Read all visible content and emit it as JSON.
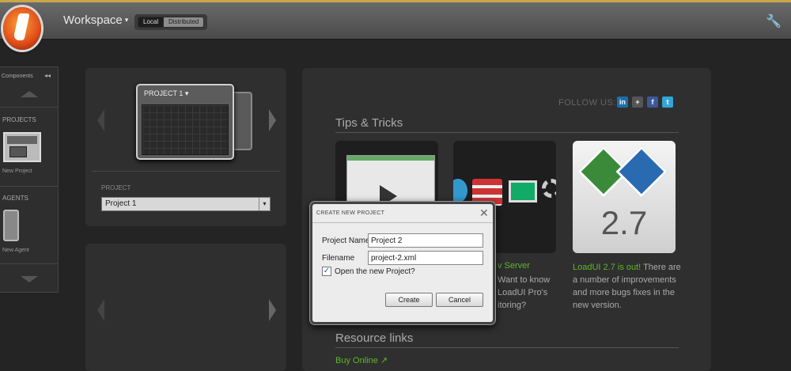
{
  "colors": {
    "accent_green": "#5cb82a",
    "logo_orange": "#e4521a"
  },
  "topbar": {
    "workspace_label": "Workspace",
    "workspace_caret": "▾",
    "mode_local": "Local",
    "mode_distributed": "Distributed",
    "wrench_glyph": "🔧"
  },
  "sidebar": {
    "title": "Components",
    "collapse_glyph": "◂◂",
    "projects_label": "PROJECTS",
    "new_project": "New Project",
    "agents_label": "AGENTS",
    "new_agent": "New Agent"
  },
  "project_panel": {
    "card_title": "PROJECT 1 ▾",
    "field_label": "PROJECT",
    "selected_project": "Project 1",
    "select_caret": "▾"
  },
  "main": {
    "follow_us": "FOLLOW US:",
    "social": [
      {
        "icon": "linkedin-icon",
        "glyph": "in",
        "color": "#1d6ea8"
      },
      {
        "icon": "google-plus-icon",
        "glyph": "+",
        "color": "#555"
      },
      {
        "icon": "facebook-icon",
        "glyph": "f",
        "color": "#3b5998"
      },
      {
        "icon": "twitter-icon",
        "glyph": "t",
        "color": "#33a5d6"
      }
    ],
    "tips_heading": "Tips & Tricks",
    "tile2": {
      "title_fragment": "v Server",
      "lines": [
        "Want to know",
        "LoadUI Pro's",
        "itoring?"
      ]
    },
    "tile3": {
      "version": "2.7",
      "headline": "LoadUI 2.7 is out!",
      "lines": [
        " There are",
        "a number of improvements",
        "and more bugs fixes in the",
        "new version."
      ]
    },
    "resources_heading": "Resource links",
    "buy_online": "Buy Online",
    "external_glyph": "↗"
  },
  "dialog": {
    "title": "CREATE NEW PROJECT",
    "close_glyph": "✕",
    "project_name_label": "Project Name",
    "project_name_value": "Project 2",
    "filename_label": "Filename",
    "filename_value": "project-2.xml",
    "open_checked": true,
    "check_glyph": "✓",
    "open_label": "Open the new Project?",
    "create_label": "Create",
    "cancel_label": "Cancel"
  }
}
